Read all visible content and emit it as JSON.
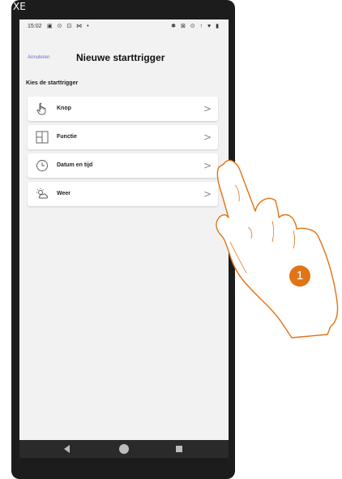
{
  "statusbar": {
    "time": "15:02",
    "left_icons": "▣ ⊙ ⊡ ⋈ •",
    "right_icons": "✱ ⊠ ⊙ ↑ ♥ ▮"
  },
  "corner_logo": "ХЕ",
  "header": {
    "cancel_label": "Annuleren",
    "title": "Nieuwe starttrigger"
  },
  "section_label": "Kies de starttrigger",
  "items": [
    {
      "label": "Knop",
      "icon": "hand-pointer-icon"
    },
    {
      "label": "Functie",
      "icon": "function-grid-icon"
    },
    {
      "label": "Datum en tijd",
      "icon": "clock-icon"
    },
    {
      "label": "Weer",
      "icon": "weather-icon"
    }
  ],
  "chevron": ">",
  "annotation": {
    "number": "1",
    "color": "#e07418"
  },
  "colors": {
    "accent": "#6a6ad8",
    "screen_bg": "#f2f2f2",
    "phone_frame": "#1c1c1c"
  }
}
